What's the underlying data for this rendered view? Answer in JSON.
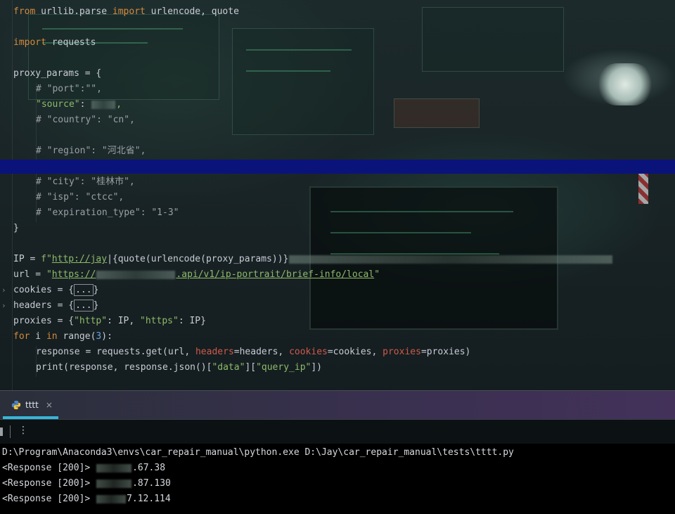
{
  "editor": {
    "lines": {
      "l1": {
        "kw1": "from",
        "mod": " urllib.parse ",
        "kw2": "import",
        "rest": " urlencode, quote"
      },
      "l2": {
        "kw": "import",
        "rest": " requests"
      },
      "l3": {
        "text": "proxy_params = {"
      },
      "l4": {
        "text": "# \"port\":\"\","
      },
      "l5": {
        "key": "\"source\"",
        "colon": ": ",
        "comma": ","
      },
      "l6": {
        "text": "# \"country\": \"cn\","
      },
      "l7": {
        "text": "# \"region\": \"河北省\","
      },
      "l8": {
        "text": "# \"city\": \"桂林市\","
      },
      "l9": {
        "text": "# \"isp\": \"ctcc\","
      },
      "l10": {
        "text": "# \"expiration_type\": \"1-3\""
      },
      "l11": {
        "text": "}"
      },
      "l12": {
        "a": "IP = ",
        "fpre": "f\"",
        "link": "http://jay",
        "cursor": "|",
        "expr": "{quote(urlencode(proxy_params))}"
      },
      "l13": {
        "a": "url = ",
        "q": "\"",
        "link_a": "https://",
        "link_b": ".api/v1/ip-portrait/brief-info/local",
        "q2": "\""
      },
      "l14": {
        "a": "cookies = {",
        "b": "...",
        "c": "}"
      },
      "l15": {
        "a": "headers = {",
        "b": "...",
        "c": "}"
      },
      "l16": {
        "a": "proxies = {",
        "s1": "\"http\"",
        "m": ": IP, ",
        "s2": "\"https\"",
        "e": ": IP}"
      },
      "l17": {
        "kw1": "for",
        "m1": " i ",
        "kw2": "in",
        "m2": " range(",
        "num": "3",
        "e": "):"
      },
      "l18": {
        "a": "response = requests.get(url, ",
        "p1": "headers",
        "b": "=headers, ",
        "p2": "cookies",
        "c": "=cookies, ",
        "p3": "proxies",
        "d": "=proxies)"
      },
      "l19": {
        "a": "print(response, response.json()[",
        "s1": "\"data\"",
        "b": "][",
        "s2": "\"query_ip\"",
        "c": "])"
      }
    },
    "fold_marker": "›"
  },
  "run_panel": {
    "tab_label": "tttt",
    "tab_close": "×",
    "more_label": "⋮",
    "console_lines": [
      {
        "text": "D:\\Program\\Anaconda3\\envs\\car_repair_manual\\python.exe D:\\Jay\\car_repair_manual\\tests\\tttt.py"
      },
      {
        "prefix": "<Response [200]> ",
        "suffix": ".67.38"
      },
      {
        "prefix": "<Response [200]> ",
        "suffix": ".87.130"
      },
      {
        "prefix": "<Response [200]> ",
        "suffix": "7.12.114"
      }
    ]
  },
  "colors": {
    "keyword": "#d48a3b",
    "string": "#8fba6a",
    "comment": "#9aa0a6",
    "number": "#6aa3e0",
    "param": "#cf5a4a",
    "highlight_line": "#0a137a",
    "tab_accent": "#37b6d8"
  },
  "icons": {
    "tab_icon": "python-icon",
    "toolbar": [
      "stop-icon",
      "more-vertical-icon"
    ]
  }
}
